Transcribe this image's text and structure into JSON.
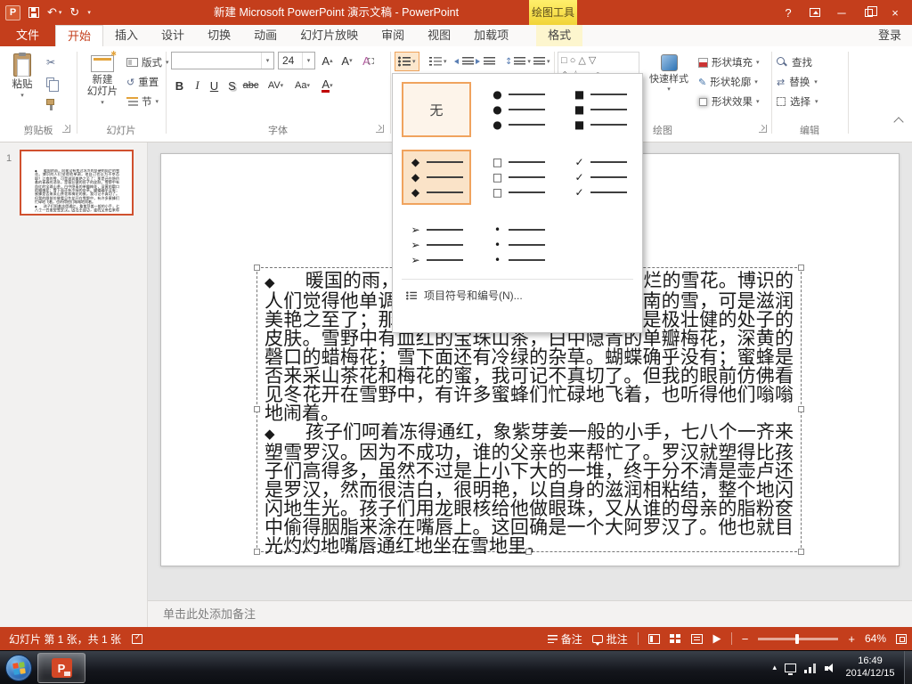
{
  "titlebar": {
    "title": "新建 Microsoft PowerPoint 演示文稿 - PowerPoint",
    "contextual_group": "绘图工具",
    "help": "?"
  },
  "tabs": {
    "file": "文件",
    "home": "开始",
    "insert": "插入",
    "design": "设计",
    "transitions": "切换",
    "animations": "动画",
    "slideshow": "幻灯片放映",
    "review": "审阅",
    "view": "视图",
    "addins": "加载项",
    "format": "格式",
    "sign_in": "登录"
  },
  "ribbon": {
    "clipboard": {
      "label": "剪贴板",
      "paste": "粘贴"
    },
    "slides": {
      "label": "幻灯片",
      "new_slide_line1": "新建",
      "new_slide_line2": "幻灯片",
      "layout": "版式",
      "reset": "重置",
      "section": "节"
    },
    "font": {
      "label": "字体",
      "name": "",
      "size": "24",
      "bold": "B",
      "italic": "I",
      "underline": "U",
      "shadow": "S",
      "strike": "abc",
      "spacing": "AV",
      "case": "Aa",
      "color": "A"
    },
    "drawing": {
      "label": "绘图",
      "shapes_row1": "□ ○ △ ▽",
      "shapes_row2": "◇ ☆ ▭ ○",
      "quick_styles": "快速样式",
      "shape_fill": "形状填充",
      "shape_outline": "形状轮廓",
      "shape_effects": "形状效果"
    },
    "editing": {
      "label": "编辑",
      "find": "查找",
      "replace": "替换",
      "select": "选择"
    }
  },
  "bullet_menu": {
    "none": "无",
    "bullets": {
      "disc": "●",
      "square": "■",
      "diamond": "◆",
      "hollow_square": "□",
      "check": "✓",
      "arrow": "➢",
      "dot": "•"
    },
    "footer": "项目符号和编号(N)..."
  },
  "slide_panel": {
    "slide_number": "1"
  },
  "slide": {
    "bullet": "◆",
    "paragraphs": [
      {
        "text": "暖国的雨，向来没有变过冰冷的坚硬的灿烂的雪花。博识的人们觉得他单调，他自己也以为不幸否耶？江南的雪，可是滋润美艳之至了；那是还在隐约着的青春的消息，是极壮健的处子的皮肤。雪野中有血红的宝珠山茶，白中隐青的单瓣梅花，深黄的磬口的蜡梅花；雪下面还有冷绿的杂草。蝴蝶确乎没有；蜜蜂是否来采山茶花和梅花的蜜，我可记不真切了。但我的眼前仿佛看见冬花开在雪野中，有许多蜜蜂们忙碌地飞着，也听得他们嗡嗡地闹着。"
      },
      {
        "text": "孩子们呵着冻得通红，象紫芽姜一般的小手，七八个一齐来塑雪罗汉。因为不成功，谁的父亲也来帮忙了。罗汉就塑得比孩子们高得多，虽然不过是上小下大的一堆，终于分不清是壶卢还是罗汉，然而很洁白，很明艳，以自身的滋润相粘结，整个地闪闪地生光。孩子们用龙眼核给他做眼珠，又从谁的母亲的脂粉奁中偷得胭脂来涂在嘴唇上。这回确是一个大阿罗汉了。他也就目光灼灼地嘴唇通红地坐在雪地里。"
      }
    ]
  },
  "notes": {
    "placeholder": "单击此处添加备注"
  },
  "statusbar": {
    "slide_info": "幻灯片 第 1 张，共 1 张",
    "notes": "备注",
    "comments": "批注",
    "zoom": "64%"
  },
  "taskbar": {
    "time": "16:49",
    "date": "2014/12/15"
  },
  "icons": {
    "app_letter": "P",
    "undo": "↶",
    "redo": "↻",
    "dropdown": "▾",
    "minimize": "─",
    "close": "×",
    "scissors": "✂",
    "reset_arrow": "↺",
    "spacing_updown": "↕",
    "pencil": "✎",
    "replace_arrows": "⇄",
    "tray_chevron": "▴"
  }
}
